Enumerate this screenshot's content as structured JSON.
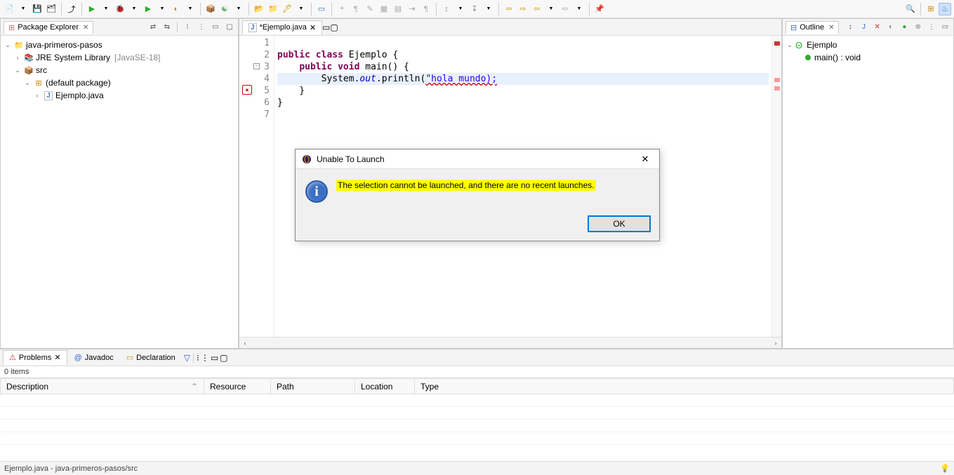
{
  "toolbar_icons": [
    "new",
    "save",
    "save-all",
    "print",
    "skip",
    "run-dd",
    "debug-dd",
    "run-ext",
    "run-cfg",
    "build",
    "sync",
    "open-task",
    "open-type",
    "search",
    "prev",
    "next",
    "format",
    "toggle",
    "goto",
    "back",
    "fwd",
    "nav-back",
    "nav-fwd",
    "last",
    "pin"
  ],
  "package_explorer": {
    "title": "Package Explorer",
    "project": "java-primeros-pasos",
    "jre": "JRE System Library",
    "jre_suffix": "[JavaSE-18]",
    "src": "src",
    "pkg": "(default package)",
    "file": "Ejemplo.java"
  },
  "editor": {
    "tab_title": "*Ejemplo.java",
    "lines": [
      {
        "n": 1,
        "html": ""
      },
      {
        "n": 2,
        "html": "<span class='kw'>public</span> <span class='kw'>class</span> Ejemplo {"
      },
      {
        "n": 3,
        "html": "    <span class='kw'>public</span> <span class='kw'>void</span> main() {",
        "fold": true
      },
      {
        "n": 4,
        "html": "        System.<span class='fld'>out</span>.println(<span class='str err-underline'>\"hola mundo);</span>",
        "err": true,
        "hl": true
      },
      {
        "n": 5,
        "html": "    }"
      },
      {
        "n": 6,
        "html": "}"
      },
      {
        "n": 7,
        "html": ""
      }
    ]
  },
  "outline": {
    "title": "Outline",
    "class": "Ejemplo",
    "method": "main() : void"
  },
  "dialog": {
    "title": "Unable To Launch",
    "message": "The selection cannot be launched, and there are no recent launches.",
    "ok": "OK"
  },
  "problems": {
    "tabs": [
      "Problems",
      "Javadoc",
      "Declaration"
    ],
    "items_text": "0 items",
    "columns": [
      "Description",
      "Resource",
      "Path",
      "Location",
      "Type"
    ]
  },
  "status": "Ejemplo.java - java-primeros-pasos/src"
}
